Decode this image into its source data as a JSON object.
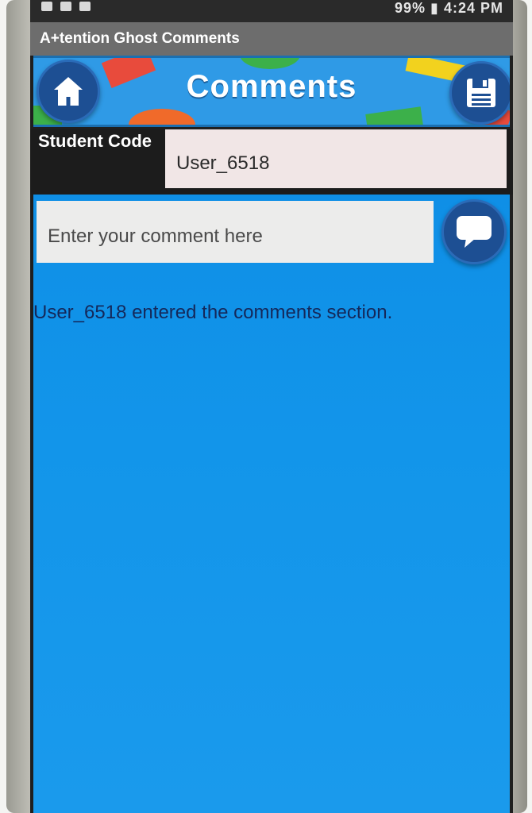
{
  "status_bar": {
    "time": "99% ▮ 4:24 PM"
  },
  "app": {
    "title": "A+tention Ghost Comments"
  },
  "banner": {
    "title": "Comments",
    "left_icon": "home-icon",
    "right_icon": "save-floppy-icon"
  },
  "student_code": {
    "label": "Student Code",
    "value": "User_6518"
  },
  "comment": {
    "placeholder": "Enter your comment here",
    "value": "",
    "send_icon": "speech-bubble-icon"
  },
  "log": {
    "message": "User_6518 entered the comments section."
  },
  "colors": {
    "title_bar": "#6d6d6d",
    "banner_bg": "#2f9ae6",
    "button_bg": "#1d4f93",
    "main_bg": "#1295ea",
    "code_field_bg": "#f1e6e6",
    "log_text": "#14285a"
  }
}
